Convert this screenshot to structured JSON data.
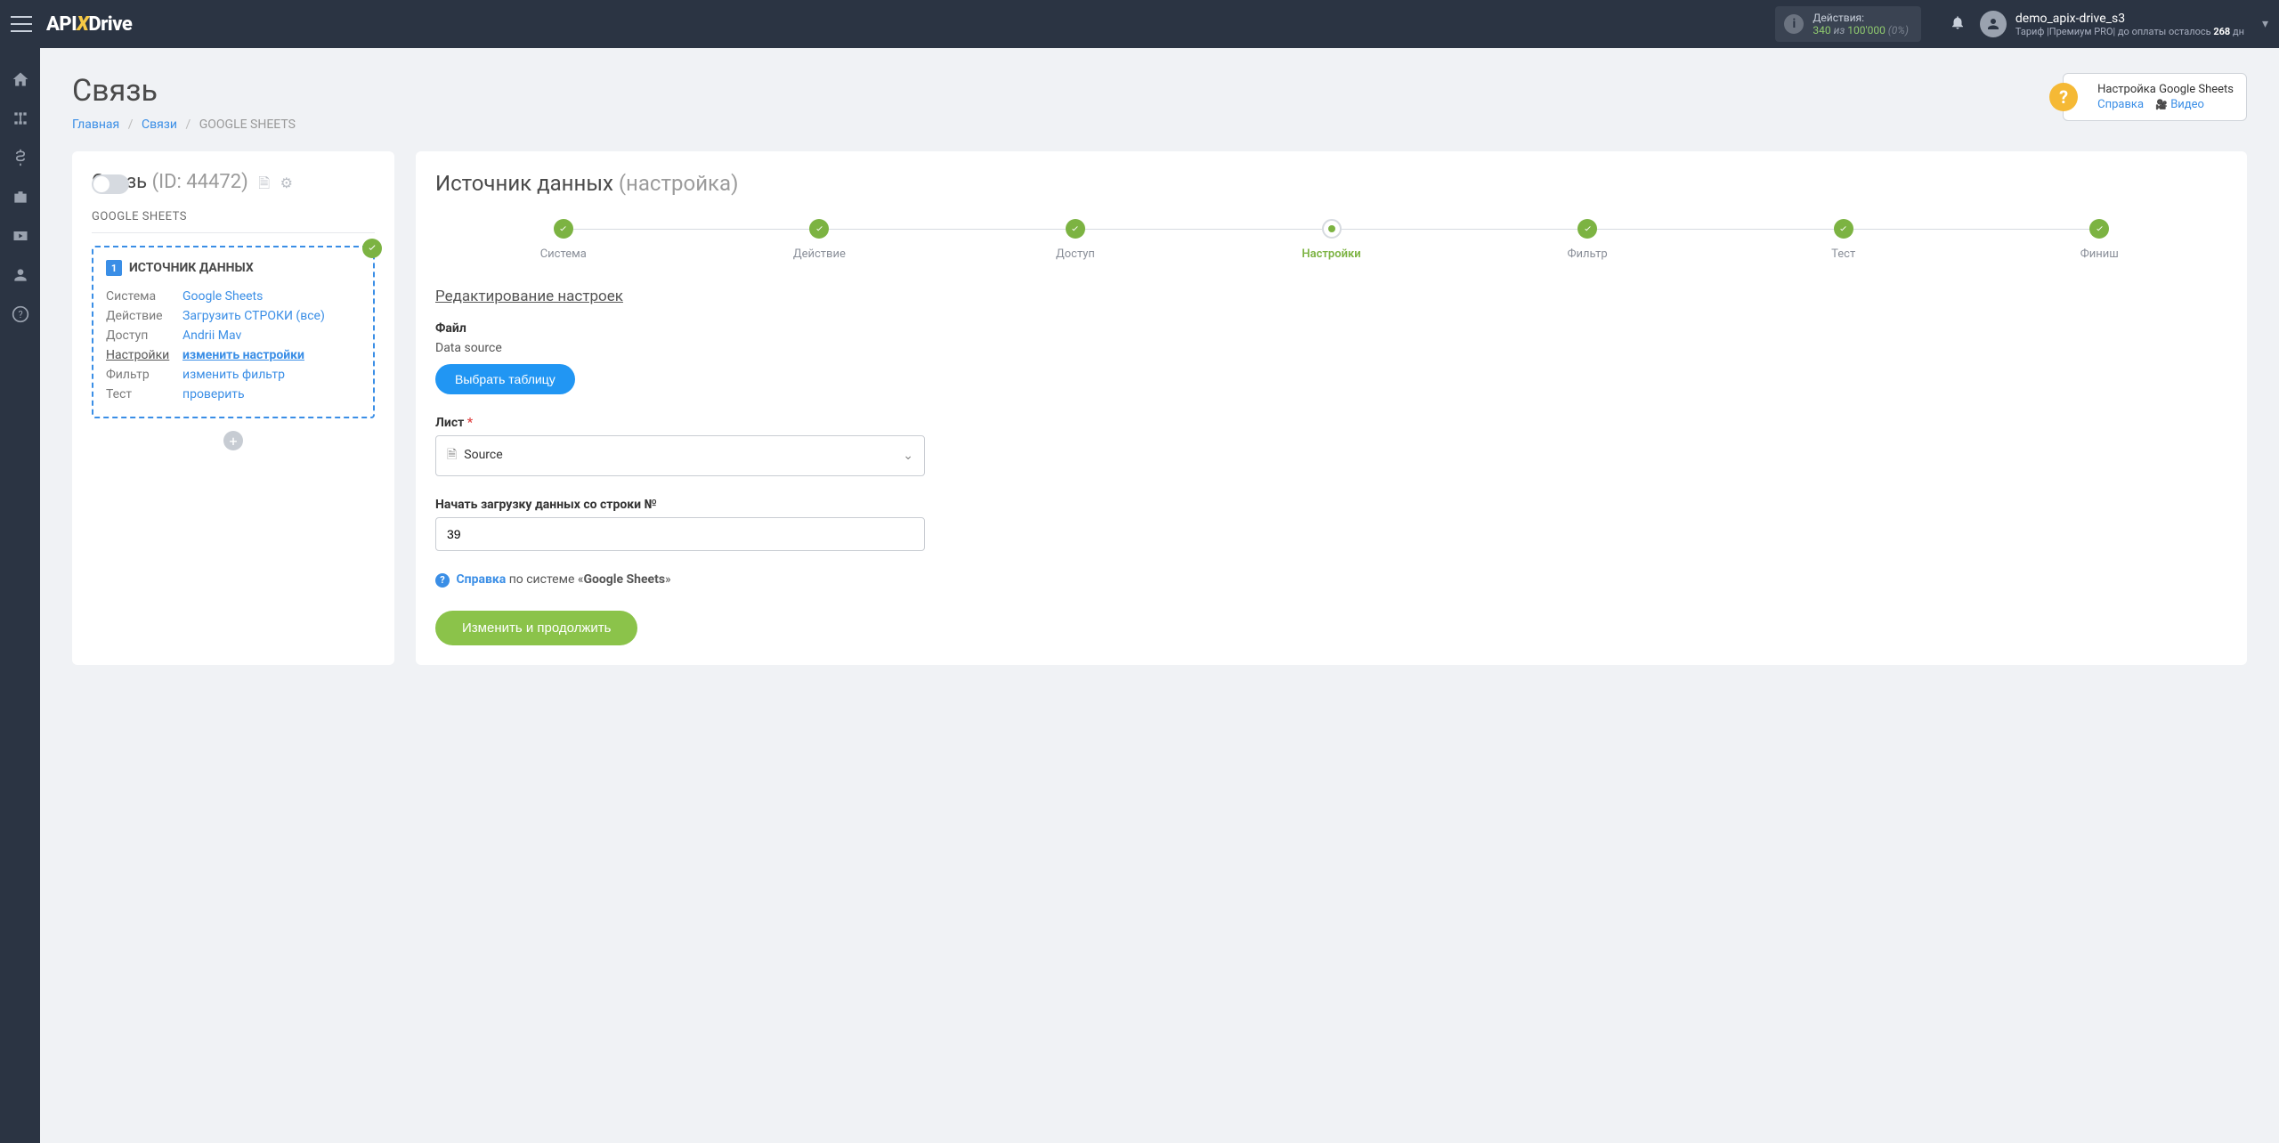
{
  "header": {
    "logo_a": "API",
    "logo_b": "Drive",
    "actions_label": "Действия:",
    "actions_count": "340",
    "actions_of": "из",
    "actions_total": "100'000",
    "actions_pct": "(0%)",
    "user_name": "demo_apix-drive_s3",
    "user_plan_prefix": "Тариф |Премиум PRO| до оплаты осталось ",
    "user_days": "268",
    "user_days_suffix": " дн"
  },
  "page": {
    "title": "Связь",
    "breadcrumb_home": "Главная",
    "breadcrumb_links": "Связи",
    "breadcrumb_current": "GOOGLE SHEETS"
  },
  "helpbox": {
    "title": "Настройка Google Sheets",
    "link_ref": "Справка",
    "link_video": "Видео"
  },
  "left": {
    "title": "Связь",
    "id_label": "(ID: 44472)",
    "subtitle": "GOOGLE SHEETS",
    "source_title": "ИСТОЧНИК ДАННЫХ",
    "rows": [
      {
        "k": "Система",
        "v": "Google Sheets"
      },
      {
        "k": "Действие",
        "v": "Загрузить СТРОКИ (все)"
      },
      {
        "k": "Доступ",
        "v": "Andrii Mav"
      },
      {
        "k": "Настройки",
        "v": "изменить настройки"
      },
      {
        "k": "Фильтр",
        "v": "изменить фильтр"
      },
      {
        "k": "Тест",
        "v": "проверить"
      }
    ]
  },
  "right": {
    "title": "Источник данных",
    "title_sub": "(настройка)",
    "steps": [
      "Система",
      "Действие",
      "Доступ",
      "Настройки",
      "Фильтр",
      "Тест",
      "Финиш"
    ],
    "section_title": "Редактирование настроек",
    "file_label": "Файл",
    "file_value": "Data source",
    "file_button": "Выбрать таблицу",
    "sheet_label": "Лист",
    "sheet_value": "Source",
    "row_label": "Начать загрузку данных со строки №",
    "row_value": "39",
    "help_text1": "Справка",
    "help_text2": " по системе «",
    "help_text3": "Google Sheets",
    "help_text4": "»",
    "submit": "Изменить и продолжить"
  }
}
